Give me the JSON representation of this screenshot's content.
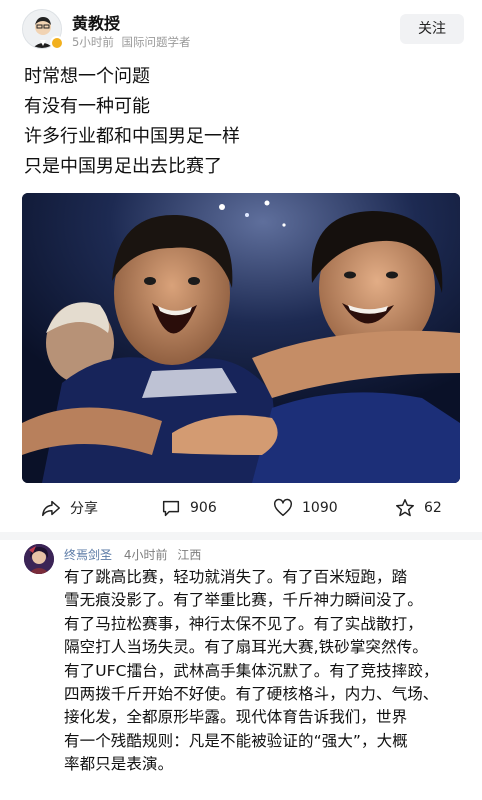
{
  "header": {
    "author_name": "黄教授",
    "time": "5小时前",
    "tagline": "国际问题学者",
    "follow_label": "关注"
  },
  "post": {
    "lines": [
      "时常想一个问题",
      "有没有一种可能",
      "许多行业都和中国男足一样",
      "只是中国男足出去比赛了"
    ]
  },
  "actions": {
    "share_label": "分享",
    "comments_count": "906",
    "likes_count": "1090",
    "favorites_count": "62"
  },
  "comment": {
    "author_name": "终焉剑圣",
    "time": "4小时前",
    "location": "江西",
    "lines": [
      "有了跳高比赛，轻功就消失了。有了百米短跑，踏",
      "雪无痕没影了。有了举重比赛，千斤神力瞬间没了。",
      "有了马拉松赛事，神行太保不见了。有了实战散打，",
      "隔空打人当场失灵。有了扇耳光大赛,铁砂掌突然传。",
      "有了UFC擂台，武林高手集体沉默了。有了竞技摔跤，",
      "四两拨千斤开始不好使。有了硬核格斗，内力、气场、",
      "接化发，全都原形毕露。现代体育告诉我们，世界",
      "有一个残酷规则：凡是不能被验证的“强大”，大概",
      "率都只是表演。"
    ]
  },
  "colors": {
    "follow_bg": "#f1f2f4",
    "meta_gray": "#9a9a9a",
    "comment_name": "#5a7aa6",
    "verify_badge": "#f2b01e"
  },
  "icons": {
    "share": "share-arrow-icon",
    "comment": "comment-bubble-icon",
    "like": "heart-icon",
    "favorite": "star-icon"
  }
}
